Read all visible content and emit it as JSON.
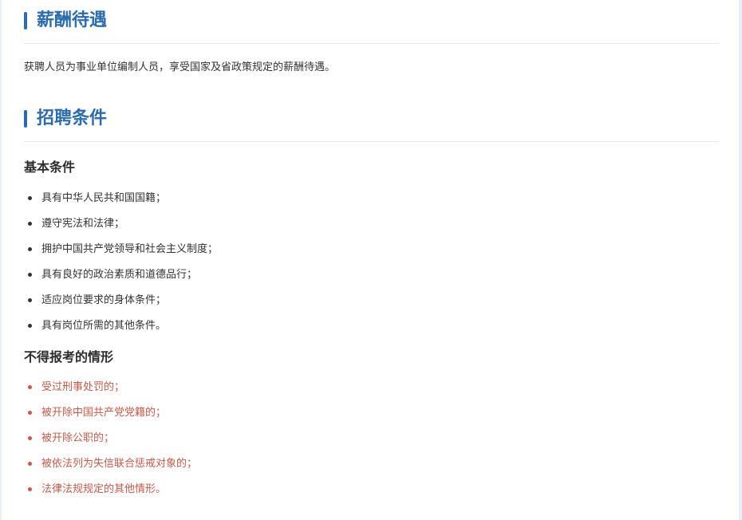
{
  "salary": {
    "title": "薪酬待遇",
    "text": "获聘人员为事业单位编制人员，享受国家及省政策规定的薪酬待遇。"
  },
  "requirements": {
    "title": "招聘条件",
    "basic": {
      "heading": "基本条件",
      "items": [
        "具有中华人民共和国国籍；",
        "遵守宪法和法律；",
        "拥护中国共产党领导和社会主义制度；",
        "具有良好的政治素质和道德品行；",
        "适应岗位要求的身体条件；",
        "具有岗位所需的其他条件。"
      ]
    },
    "excluded": {
      "heading": "不得报考的情形",
      "items": [
        "受过刑事处罚的；",
        "被开除中国共产党党籍的；",
        "被开除公职的；",
        "被依法列为失信联合惩戒对象的；",
        "法律法规规定的其他情形。"
      ]
    }
  },
  "colors": {
    "accent": "#2b6cb0",
    "warning_text": "#c75a48",
    "body_text": "#333333"
  }
}
